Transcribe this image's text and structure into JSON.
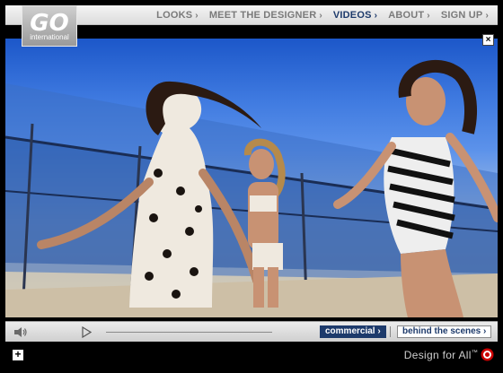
{
  "logo": {
    "main": "GO",
    "sub": "international"
  },
  "nav": {
    "items": [
      {
        "label": "LOOKS",
        "active": false
      },
      {
        "label": "MEET THE DESIGNER",
        "active": false
      },
      {
        "label": "VIDEOS",
        "active": true
      },
      {
        "label": "ABOUT",
        "active": false
      },
      {
        "label": "SIGN UP",
        "active": false
      }
    ],
    "chevron": "›"
  },
  "video": {
    "close_label": "×"
  },
  "player": {
    "segments": {
      "commercial": "commercial ›",
      "behind": "behind the scenes ›"
    },
    "progress": 0
  },
  "footer": {
    "plus": "+",
    "tagline": "Design for All",
    "trademark": "™"
  },
  "colors": {
    "accent": "#1d3a6b",
    "target_red": "#cc0000"
  }
}
